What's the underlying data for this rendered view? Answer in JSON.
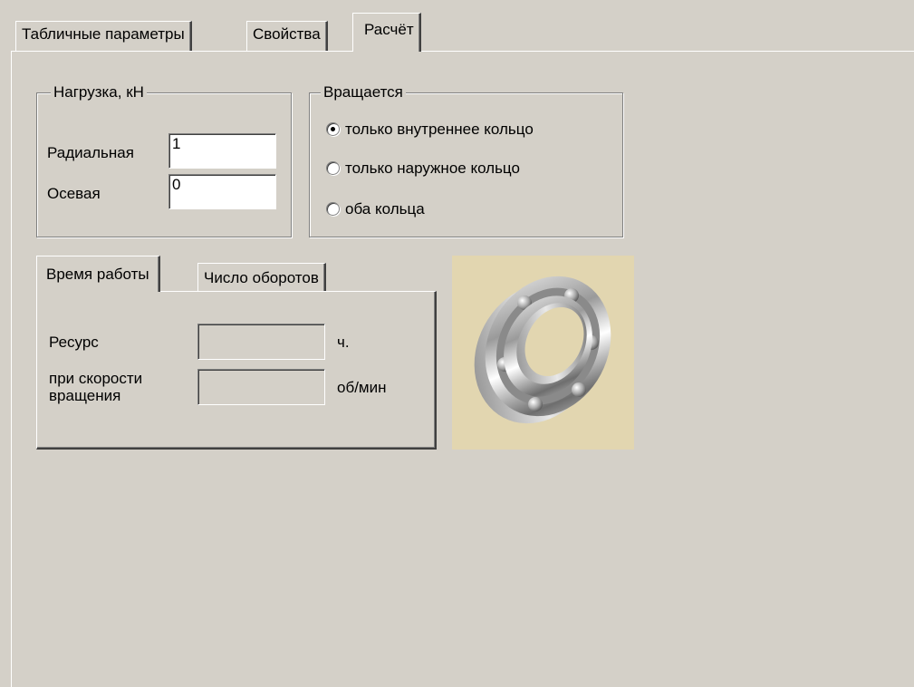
{
  "tabs": [
    {
      "label": "Табличные параметры",
      "active": false
    },
    {
      "label": "Свойства",
      "active": false
    },
    {
      "label": "Расчёт",
      "active": true
    }
  ],
  "load_group": {
    "legend": "Нагрузка, кН",
    "radial_label": "Радиальная",
    "radial_value": "1",
    "axial_label": "Осевая",
    "axial_value": "0"
  },
  "rotation_group": {
    "legend": "Вращается",
    "options": [
      {
        "label": "только внутреннее кольцо",
        "selected": true
      },
      {
        "label": "только наружное кольцо",
        "selected": false
      },
      {
        "label": "оба кольца",
        "selected": false
      }
    ]
  },
  "inner_tabs": [
    {
      "label": "Время работы",
      "active": true
    },
    {
      "label": "Число оборотов",
      "active": false
    }
  ],
  "work_time": {
    "resource_label": "Ресурс",
    "resource_value": "",
    "resource_unit": "ч.",
    "speed_label_line1": "при скорости",
    "speed_label_line2": "вращения",
    "speed_value": "",
    "speed_unit": "об/мин"
  },
  "image": {
    "icon": "ball-bearing-icon",
    "background": "#e2d6b0"
  }
}
